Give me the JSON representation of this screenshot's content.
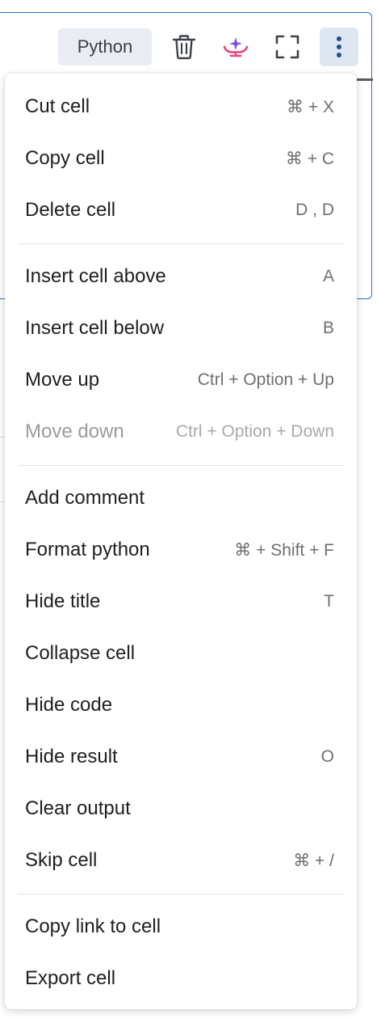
{
  "toolbar": {
    "language": "Python",
    "icons": {
      "delete": "trash-icon",
      "assistant": "assistant-sparkle-icon",
      "expand": "fullscreen-icon",
      "more": "kebab-menu-icon"
    },
    "colors": {
      "accent": "#2f6fc4",
      "more_active_bg": "#dde6f1",
      "assistant_pink": "#e8457a",
      "assistant_purple": "#7b4ee3"
    }
  },
  "menu": {
    "groups": [
      [
        {
          "label": "Cut cell",
          "shortcut": "⌘ + X",
          "disabled": false
        },
        {
          "label": "Copy cell",
          "shortcut": "⌘ + C",
          "disabled": false
        },
        {
          "label": "Delete cell",
          "shortcut": "D , D",
          "disabled": false
        }
      ],
      [
        {
          "label": "Insert cell above",
          "shortcut": "A",
          "disabled": false
        },
        {
          "label": "Insert cell below",
          "shortcut": "B",
          "disabled": false
        },
        {
          "label": "Move up",
          "shortcut": "Ctrl + Option + Up",
          "disabled": false
        },
        {
          "label": "Move down",
          "shortcut": "Ctrl + Option + Down",
          "disabled": true
        }
      ],
      [
        {
          "label": "Add comment",
          "shortcut": "",
          "disabled": false
        },
        {
          "label": "Format python",
          "shortcut": "⌘ + Shift + F",
          "disabled": false
        },
        {
          "label": "Hide title",
          "shortcut": "T",
          "disabled": false
        },
        {
          "label": "Collapse cell",
          "shortcut": "",
          "disabled": false
        },
        {
          "label": "Hide code",
          "shortcut": "",
          "disabled": false
        },
        {
          "label": "Hide result",
          "shortcut": "O",
          "disabled": false
        },
        {
          "label": "Clear output",
          "shortcut": "",
          "disabled": false
        },
        {
          "label": "Skip cell",
          "shortcut": "⌘ + /",
          "disabled": false
        }
      ],
      [
        {
          "label": "Copy link to cell",
          "shortcut": "",
          "disabled": false
        },
        {
          "label": "Export cell",
          "shortcut": "",
          "disabled": false
        }
      ]
    ]
  }
}
